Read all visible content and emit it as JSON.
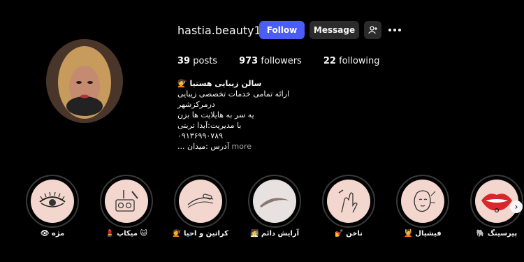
{
  "profile": {
    "username": "hastia.beauty1",
    "follow_label": "Follow",
    "message_label": "Message",
    "add_person_icon": "person-add-icon",
    "more_icon": "more-options-icon"
  },
  "stats": {
    "posts_count": "39",
    "posts_label": "posts",
    "followers_count": "973",
    "followers_label": "followers",
    "following_count": "22",
    "following_label": "following"
  },
  "bio": {
    "name": "سالن زیبایی هستیا 💇",
    "line1": "ارائه تمامی خدمات تخصصی زیبایی درمرکزشهر",
    "line2": "یه سر به هایلایت ها بزن",
    "line3": "با مدیریت:آیدا تربتی",
    "line4": "۰۹۱۳۶۹۹۰۷۸۹",
    "line5": "آدرس :میدان ...",
    "more_label": "more"
  },
  "highlights": [
    {
      "label": "👁 مژه",
      "icon": "eyelash-icon"
    },
    {
      "label": "💄 میکاپ 🐱",
      "icon": "makeup-brush-icon"
    },
    {
      "label": "💇 کراتین و احیا",
      "icon": "hair-brush-icon"
    },
    {
      "label": "🧖 آرایش دائم",
      "icon": "eyebrow-icon"
    },
    {
      "label": "💅 ناخن",
      "icon": "nail-icon"
    },
    {
      "label": "💆 فیشیال",
      "icon": "facial-icon"
    },
    {
      "label": "🐘 پیرسینگ",
      "icon": "lip-piercing-icon"
    }
  ],
  "colors": {
    "background": "#000000",
    "follow_button": "#4a5df9",
    "secondary_button": "#2b2b2b",
    "highlight_fill": "#f3d7cf"
  }
}
